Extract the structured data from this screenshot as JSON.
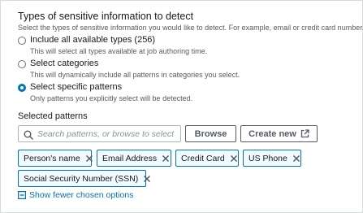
{
  "section": {
    "title": "Types of sensitive information to detect",
    "description": "Select the types of sensitive information you would like to detect. For example, email or credit card number."
  },
  "options": [
    {
      "label": "Include all available types (256)",
      "sub": "This will select all types available at job authoring time.",
      "selected": false
    },
    {
      "label": "Select categories",
      "sub": "This will dynamically include all patterns in categories you select.",
      "selected": false
    },
    {
      "label": "Select specific patterns",
      "sub": "Only patterns you explicitly select will be detected.",
      "selected": true
    }
  ],
  "selected_patterns": {
    "label": "Selected patterns",
    "search_placeholder": "Search patterns, or browse to select",
    "browse_label": "Browse",
    "create_label": "Create new",
    "tokens": [
      "Person's name",
      "Email Address",
      "Credit Card",
      "US Phone",
      "Social Security Number (SSN)"
    ],
    "show_fewer_label": "Show fewer chosen options"
  },
  "colors": {
    "accent": "#0073bb",
    "token_bg": "#f1faff",
    "muted_text": "#545b64"
  }
}
